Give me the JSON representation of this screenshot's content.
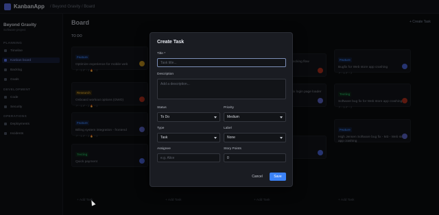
{
  "app": {
    "brand": "KanbanApp",
    "breadcrumb": "/ Beyond Gravity / Board"
  },
  "sidebar": {
    "project_name": "Beyond Gravity",
    "project_sub": "Software project",
    "sections": [
      {
        "label": "PLANNING",
        "items": [
          {
            "label": "Timeline",
            "active": false
          },
          {
            "label": "Kanban board",
            "active": true
          },
          {
            "label": "Backlog",
            "active": false
          },
          {
            "label": "Goals",
            "active": false
          }
        ]
      },
      {
        "label": "DEVELOPMENT",
        "items": [
          {
            "label": "Code",
            "active": false
          },
          {
            "label": "Security",
            "active": false
          }
        ]
      },
      {
        "label": "OPERATIONS",
        "items": [
          {
            "label": "Deployments",
            "active": false
          },
          {
            "label": "Incidents",
            "active": false
          }
        ]
      }
    ]
  },
  "board": {
    "title": "Board",
    "create_label": "+ Create Task",
    "add_task_label": "+ Add Task",
    "columns": [
      {
        "name": "TO DO",
        "cards": [
          {
            "tag": "Feature",
            "tag_color": "#3b82f6",
            "title": "Optimize experience for mobile web",
            "meta": "↗ ~ 5 ✐ ~ 2 🔥 ~ 2",
            "avatar_color": "#c8961e"
          },
          {
            "tag": "Research",
            "tag_color": "#d6a22a",
            "title": "Onboard workout options (OWO)",
            "meta": "↗ ~ 5 ✐ ~ 2 🔥 ~ 2",
            "avatar_color": "#b3301e"
          },
          {
            "tag": "Feature",
            "tag_color": "#3b82f6",
            "title": "Billing system integration - frontend",
            "meta": "↗ ~ 5 ✐ ~ 2 🔥 ~ 2",
            "avatar_color": "#5a64c8"
          },
          {
            "tag": "Testing",
            "tag_color": "#22a35a",
            "title": "Quick payment",
            "meta": "",
            "avatar_color": "#4a64d8"
          }
        ]
      },
      {
        "name": "",
        "cards": []
      },
      {
        "name": "",
        "cards": [
          {
            "tag": "",
            "tag_color": "#9aa0ab",
            "title": "...tracking flow",
            "meta": "",
            "avatar_color": "#b3301e"
          },
          {
            "tag": "",
            "tag_color": "#9aa0ab",
            "title": "...Fix login page loader",
            "meta": "",
            "avatar_color": "#5a64c8"
          },
          {
            "tag": "",
            "tag_color": "#9aa0ab",
            "title": "",
            "meta": "",
            "avatar_color": "#4a64d8"
          }
        ]
      },
      {
        "name": "",
        "cards": [
          {
            "tag": "Feature",
            "tag_color": "#3b82f6",
            "title": "Bugfix for Web store app crashing",
            "meta": "↗ ~ 5 ✐ ~ 2",
            "avatar_color": "#4a64d8"
          },
          {
            "tag": "Testing",
            "tag_color": "#22a35a",
            "title": "Software bug fix for Web store app crashing",
            "meta": "↗ ~ 5 ✐ ~ 2",
            "avatar_color": "#b3301e"
          },
          {
            "tag": "Feature",
            "tag_color": "#3b82f6",
            "title": "High Jensen Software bug fix - M3 - Web store app crashing",
            "meta": "",
            "avatar_color": "#5a64c8"
          }
        ]
      }
    ]
  },
  "modal": {
    "title": "Create Task",
    "title_label": "Title *",
    "title_placeholder": "Task title...",
    "description_label": "Description",
    "description_placeholder": "Add a description...",
    "status_label": "Status",
    "status_value": "To Do",
    "priority_label": "Priority",
    "priority_value": "Medium",
    "type_label": "Type",
    "type_value": "Task",
    "label_label": "Label",
    "label_value": "None",
    "assignee_label": "Assignee",
    "assignee_placeholder": "e.g. Alice",
    "story_points_label": "Story Points",
    "story_points_value": "0",
    "cancel_label": "Cancel",
    "save_label": "Save"
  }
}
